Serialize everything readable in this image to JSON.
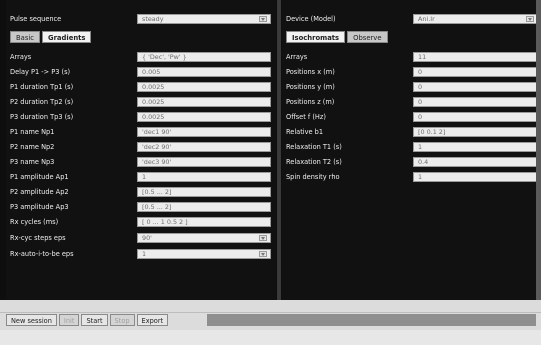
{
  "left": {
    "pulse_sequence_label": "Pulse sequence",
    "pulse_sequence_value": "steady",
    "tabs": [
      {
        "label": "Basic"
      },
      {
        "label": "Gradients"
      }
    ],
    "fields": [
      {
        "label": "Arrays",
        "value": "{ 'Dec', 'Pw' }"
      },
      {
        "label": "Delay P1 -> P3 (s)",
        "value": "0.005"
      },
      {
        "label": "P1 duration Tp1 (s)",
        "value": "0.0025"
      },
      {
        "label": "P2 duration Tp2 (s)",
        "value": "0.0025"
      },
      {
        "label": "P3 duration Tp3 (s)",
        "value": "0.0025"
      },
      {
        "label": "P1 name Np1",
        "value": "'dec1 90'"
      },
      {
        "label": "P2 name Np2",
        "value": "'dec2 90'"
      },
      {
        "label": "P3 name Np3",
        "value": "'dec3 90'"
      },
      {
        "label": "P1 amplitude Ap1",
        "value": "1"
      },
      {
        "label": "P2 amplitude Ap2",
        "value": "[0.5 ... 2]"
      },
      {
        "label": "P3 amplitude Ap3",
        "value": "[0.5 ... 2]"
      },
      {
        "label": "Rx cycles (ms)",
        "value": "[ 0 ... 1 0.5 2 ]"
      }
    ],
    "selects": [
      {
        "label": "Rx-cyc steps eps",
        "value": "90'"
      },
      {
        "label": "Rx-auto-i-to-be eps",
        "value": "1"
      }
    ]
  },
  "right": {
    "device_label": "Device (Model)",
    "device_value": "Ani.Ir",
    "tabs": [
      {
        "label": "Isochromats"
      },
      {
        "label": "Observe"
      }
    ],
    "fields": [
      {
        "label": "Arrays",
        "value": "11"
      },
      {
        "label": "Positions x (m)",
        "value": "0"
      },
      {
        "label": "Positions y (m)",
        "value": "0"
      },
      {
        "label": "Positions z (m)",
        "value": "0"
      },
      {
        "label": "Offset f (Hz)",
        "value": "0"
      },
      {
        "label": "Relative b1",
        "value": "[0 0.1 2]"
      },
      {
        "label": "Relaxation T1 (s)",
        "value": "1"
      },
      {
        "label": "Relaxation T2 (s)",
        "value": "0.4"
      },
      {
        "label": "Spin density rho",
        "value": "1"
      }
    ]
  },
  "toolbar": {
    "new_session": "New session",
    "init": "Init",
    "start": "Start",
    "stop": "Stop",
    "export": "Export"
  }
}
